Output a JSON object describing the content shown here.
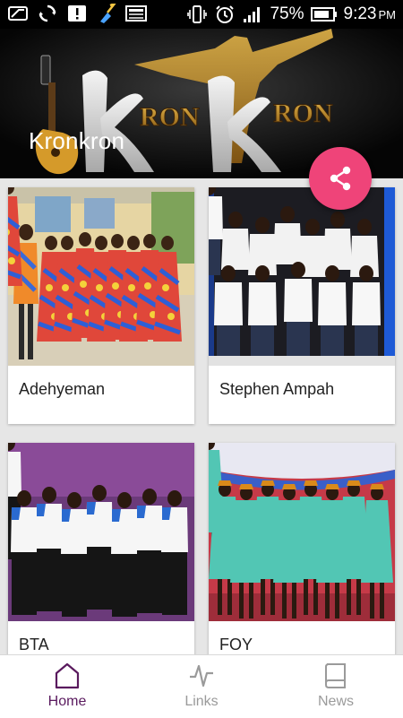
{
  "status_bar": {
    "battery_percent": "75%",
    "time": "9:23",
    "ampm": "PM",
    "left_icons": [
      "screen-icon",
      "sync-icon",
      "alert-icon",
      "broom-icon",
      "gallery-icon"
    ],
    "right_icons": [
      "vibrate-icon",
      "alarm-icon",
      "signal-icon",
      "battery-icon"
    ]
  },
  "header": {
    "title": "Kronkron",
    "logo_text": "KronKron"
  },
  "share_button": {
    "icon": "share-icon",
    "color": "#ef4479"
  },
  "cards": [
    {
      "label": "Adehyeman"
    },
    {
      "label": "Stephen Ampah"
    },
    {
      "label": "BTA"
    },
    {
      "label": "FOY"
    }
  ],
  "bottom_nav": {
    "items": [
      {
        "label": "Home",
        "icon": "home-icon",
        "active": true
      },
      {
        "label": "Links",
        "icon": "pulse-icon",
        "active": false
      },
      {
        "label": "News",
        "icon": "book-icon",
        "active": false
      }
    ],
    "active_color": "#5a1a5e",
    "inactive_color": "#9a9a9a"
  }
}
